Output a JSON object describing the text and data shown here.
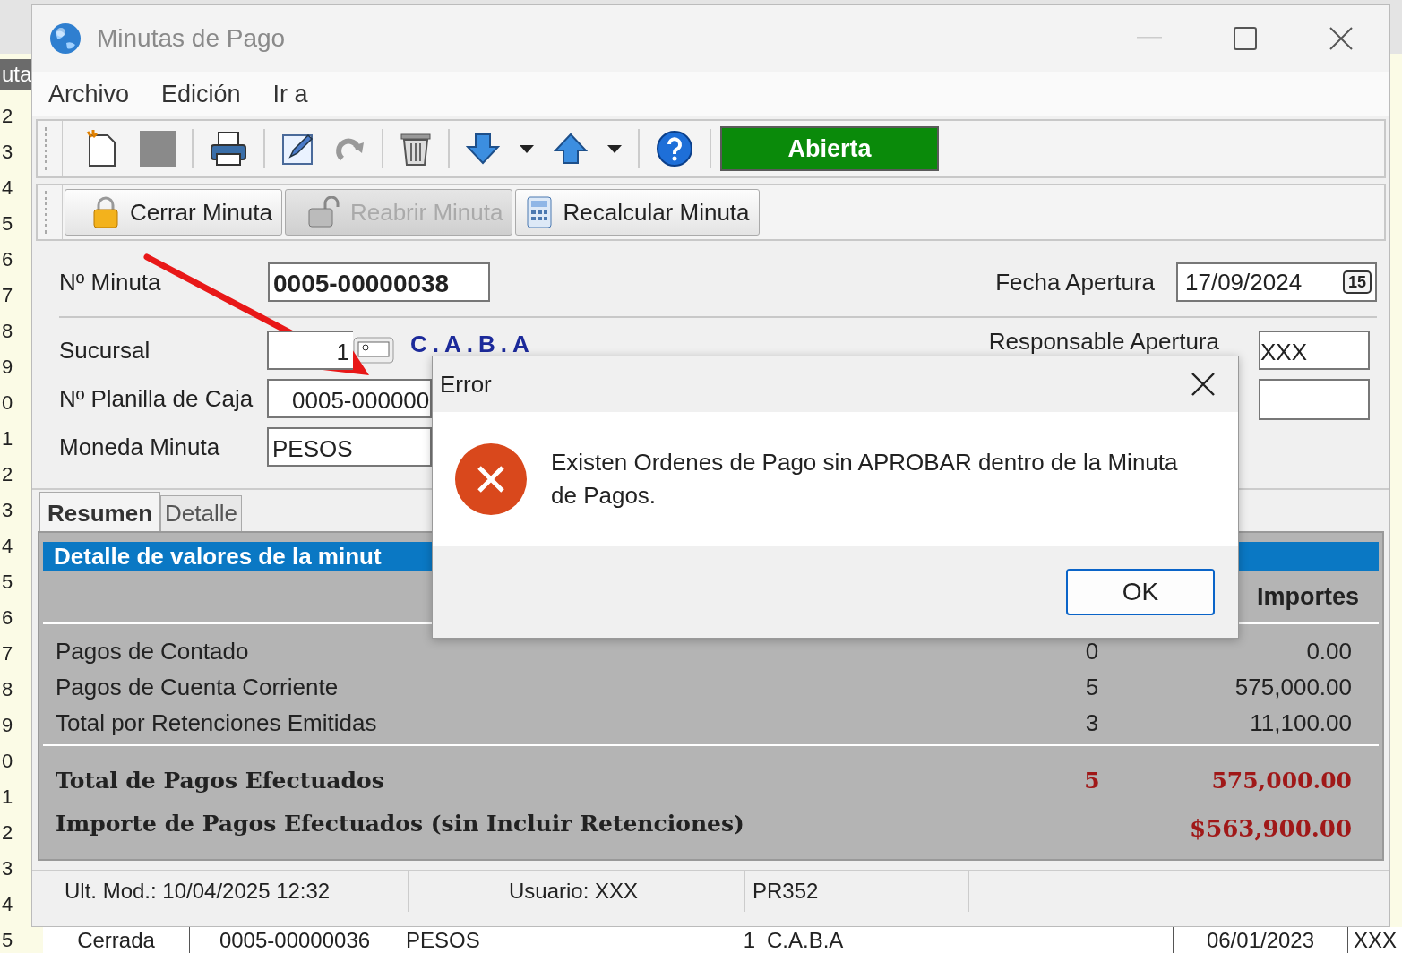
{
  "background_list": {
    "header": "uta",
    "row_numbers": [
      "2",
      "3",
      "4",
      "5",
      "6",
      "7",
      "8",
      "9",
      "0",
      "1",
      "2",
      "3",
      "4",
      "5",
      "6",
      "7",
      "8",
      "9",
      "0",
      "1",
      "2",
      "3",
      "4",
      "5"
    ],
    "visible_row": [
      "Cerrada",
      "0005-00000036",
      "PESOS",
      "1",
      "C.A.B.A",
      "06/01/2023",
      "XXX"
    ]
  },
  "window": {
    "title": "Minutas de Pago"
  },
  "menu": [
    "Archivo",
    "Edición",
    "Ir a"
  ],
  "toolbar": {
    "status": "Abierta"
  },
  "actions": [
    {
      "label": "Cerrar Minuta",
      "disabled": false
    },
    {
      "label": "Reabrir Minuta",
      "disabled": true
    },
    {
      "label": "Recalcular Minuta",
      "disabled": false
    }
  ],
  "form": {
    "minuta_label": "Nº Minuta",
    "minuta_value": "0005-00000038",
    "fecha_label": "Fecha Apertura",
    "fecha_value": "17/09/2024",
    "calendar_day": "15",
    "sucursal_label": "Sucursal",
    "sucursal_value": "1",
    "sucursal_name": "C.A.B.A",
    "responsable_label": "Responsable Apertura",
    "responsable_value": "XXX",
    "planilla_label": "Nº Planilla de Caja",
    "planilla_value": "0005-000000",
    "moneda_label": "Moneda Minuta",
    "moneda_value": "PESOS"
  },
  "tabs": [
    {
      "label": "Resumen",
      "selected": true
    },
    {
      "label": "Detalle",
      "selected": false
    }
  ],
  "summary": {
    "title": "Detalle de valores de la minut",
    "column_header": "Importes",
    "rows": [
      {
        "label": "Pagos de Contado",
        "count": "0",
        "amount": "0.00"
      },
      {
        "label": "Pagos de Cuenta Corriente",
        "count": "5",
        "amount": "575,000.00"
      },
      {
        "label": "Total por Retenciones Emitidas",
        "count": "3",
        "amount": "11,100.00"
      }
    ],
    "totals": [
      {
        "label": "Total de Pagos Efectuados",
        "count": "5",
        "amount": "575,000.00"
      },
      {
        "label": "Importe de Pagos Efectuados (sin Incluir Retenciones)",
        "amount": "$563,900.00"
      }
    ]
  },
  "dialog": {
    "title": "Error",
    "message": "Existen Ordenes de Pago sin APROBAR dentro de la Minuta de Pagos.",
    "button": "OK"
  },
  "status_bar": [
    "Ult. Mod.: 10/04/2025 12:32",
    "Usuario: XXX",
    "PR352"
  ]
}
